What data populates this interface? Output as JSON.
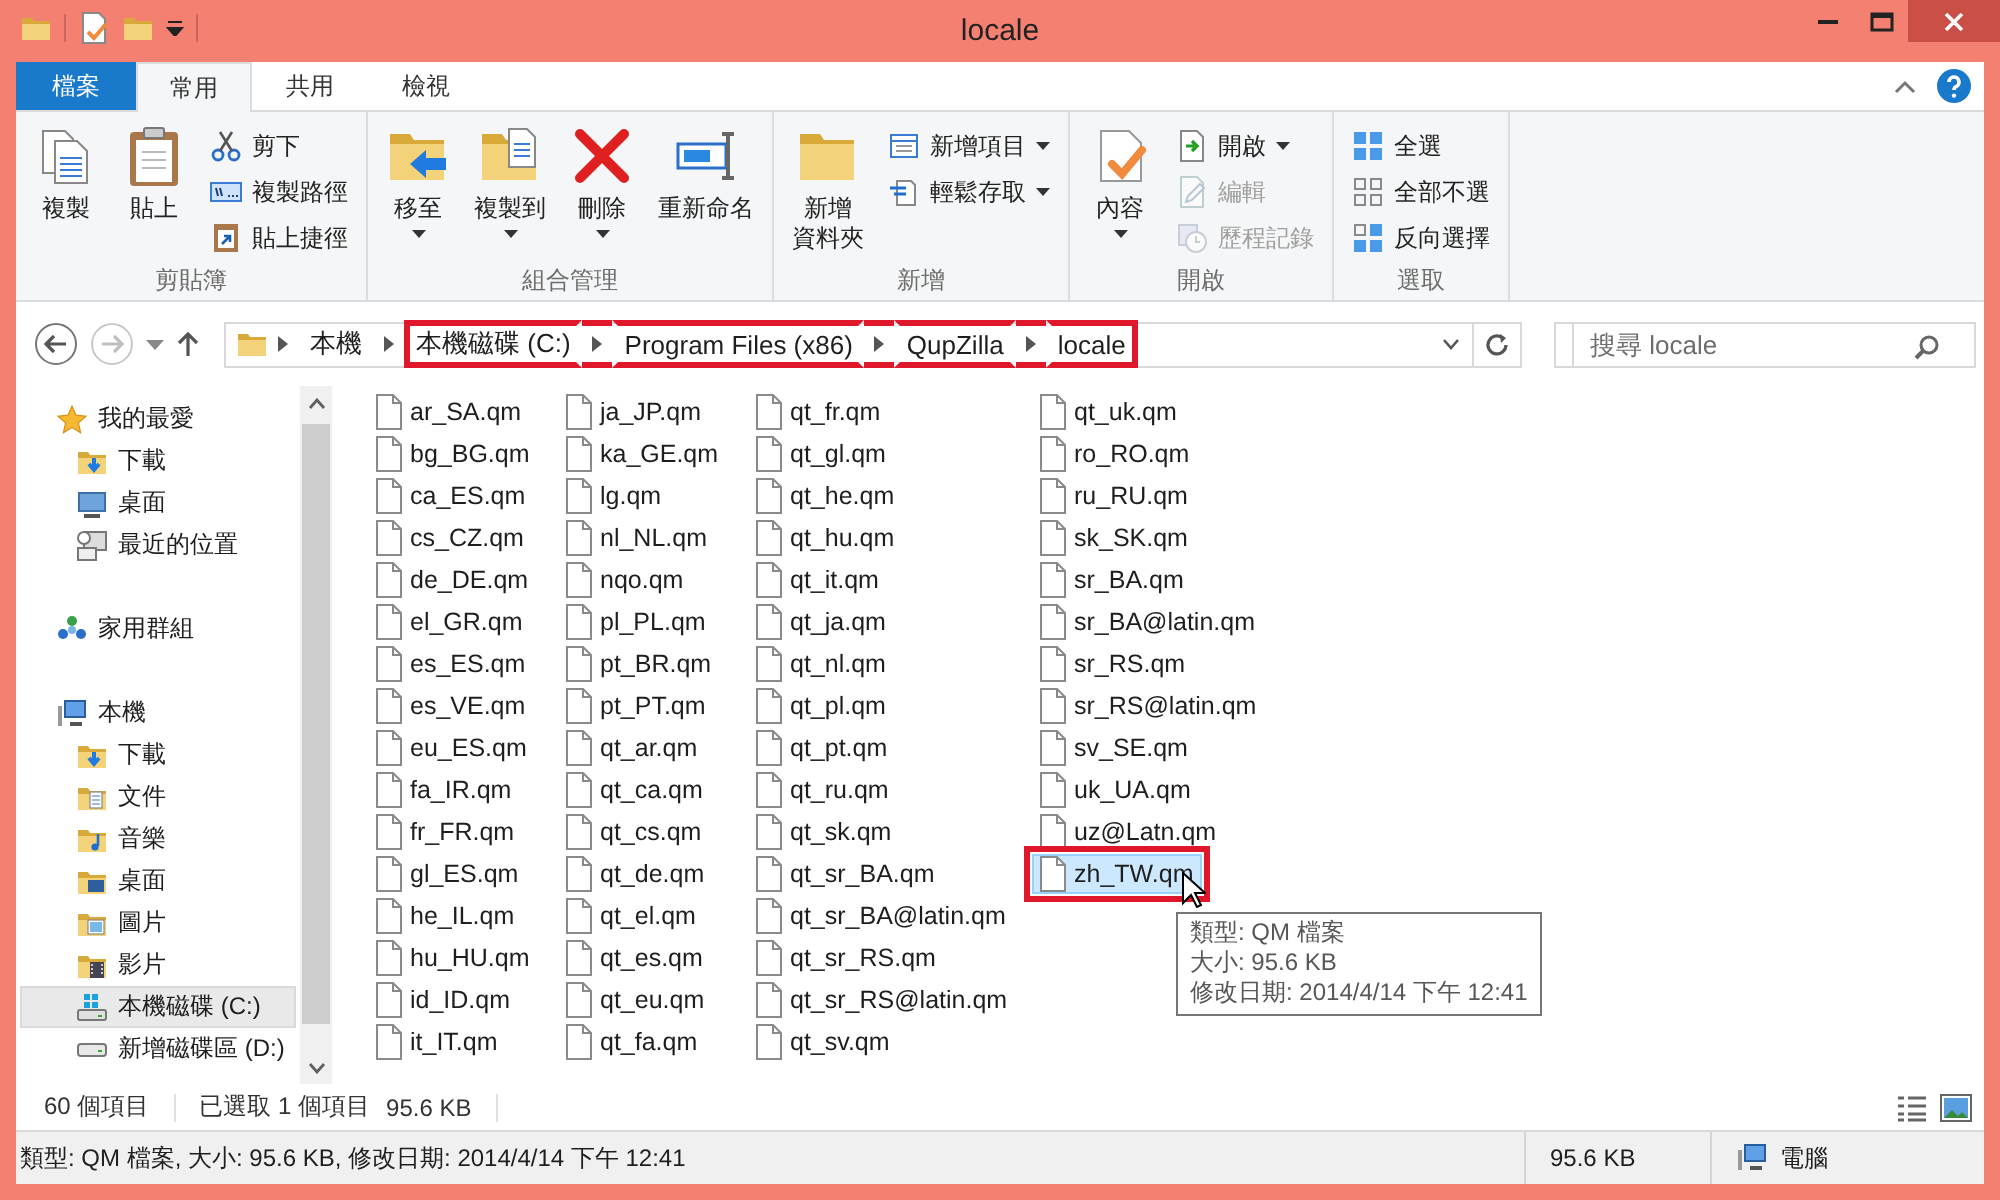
{
  "window": {
    "title": "locale"
  },
  "ribbon": {
    "file_tab": "檔案",
    "tabs": [
      {
        "label": "常用",
        "selected": true
      },
      {
        "label": "共用",
        "selected": false
      },
      {
        "label": "檢視",
        "selected": false
      }
    ],
    "groups": [
      {
        "label": "剪貼簿",
        "commands": [
          {
            "label": "複製",
            "kind": "large",
            "dropdown": false,
            "disabled": false
          },
          {
            "label": "貼上",
            "kind": "large",
            "dropdown": false,
            "disabled": false
          },
          {
            "label": "剪下",
            "kind": "small",
            "dropdown": false,
            "disabled": false
          },
          {
            "label": "複製路徑",
            "kind": "small",
            "dropdown": false,
            "disabled": false
          },
          {
            "label": "貼上捷徑",
            "kind": "small",
            "dropdown": false,
            "disabled": false
          }
        ]
      },
      {
        "label": "組合管理",
        "commands": [
          {
            "label": "移至",
            "kind": "large",
            "dropdown": true,
            "disabled": false
          },
          {
            "label": "複製到",
            "kind": "large",
            "dropdown": true,
            "disabled": false
          },
          {
            "label": "刪除",
            "kind": "large",
            "dropdown": true,
            "disabled": false
          },
          {
            "label": "重新命名",
            "kind": "large",
            "dropdown": false,
            "disabled": false
          }
        ]
      },
      {
        "label": "新增",
        "commands": [
          {
            "label_lines": [
              "新增",
              "資料夾"
            ],
            "kind": "large",
            "dropdown": false,
            "disabled": false
          },
          {
            "label": "新增項目",
            "kind": "small",
            "dropdown": true,
            "disabled": false
          },
          {
            "label": "輕鬆存取",
            "kind": "small",
            "dropdown": true,
            "disabled": false
          }
        ]
      },
      {
        "label": "開啟",
        "commands": [
          {
            "label": "內容",
            "kind": "large",
            "dropdown": true,
            "disabled": false
          },
          {
            "label": "開啟",
            "kind": "small",
            "dropdown": true,
            "disabled": false
          },
          {
            "label": "編輯",
            "kind": "small",
            "dropdown": false,
            "disabled": true
          },
          {
            "label": "歷程記錄",
            "kind": "small",
            "dropdown": false,
            "disabled": true
          }
        ]
      },
      {
        "label": "選取",
        "commands": [
          {
            "label": "全選",
            "kind": "small",
            "dropdown": false,
            "disabled": false
          },
          {
            "label": "全部不選",
            "kind": "small",
            "dropdown": false,
            "disabled": false
          },
          {
            "label": "反向選擇",
            "kind": "small",
            "dropdown": false,
            "disabled": false
          }
        ]
      }
    ]
  },
  "address": {
    "segments": [
      {
        "label": "本機",
        "annotated": false
      },
      {
        "label": "本機磁碟 (C:)",
        "annotated": true
      },
      {
        "label": "Program Files (x86)",
        "annotated": true
      },
      {
        "label": "QupZilla",
        "annotated": true
      },
      {
        "label": "locale",
        "annotated": true
      }
    ],
    "search": {
      "placeholder": "搜尋 locale"
    }
  },
  "navigation": {
    "items": [
      {
        "label": "我的最愛",
        "selected": false,
        "children": [
          {
            "label": "下載",
            "selected": false
          },
          {
            "label": "桌面",
            "selected": false
          },
          {
            "label": "最近的位置",
            "selected": false
          }
        ]
      },
      {
        "label": "家用群組",
        "selected": false
      },
      {
        "label": "本機",
        "selected": false,
        "children": [
          {
            "label": "下載",
            "selected": false
          },
          {
            "label": "文件",
            "selected": false
          },
          {
            "label": "音樂",
            "selected": false
          },
          {
            "label": "桌面",
            "selected": false
          },
          {
            "label": "圖片",
            "selected": false
          },
          {
            "label": "影片",
            "selected": false
          },
          {
            "label": "本機磁碟 (C:)",
            "selected": true
          },
          {
            "label": "新增磁碟區 (D:)",
            "selected": false
          }
        ]
      }
    ]
  },
  "files": [
    {
      "name": "ar_SA.qm",
      "selected": false,
      "annotated": false
    },
    {
      "name": "bg_BG.qm",
      "selected": false,
      "annotated": false
    },
    {
      "name": "ca_ES.qm",
      "selected": false,
      "annotated": false
    },
    {
      "name": "cs_CZ.qm",
      "selected": false,
      "annotated": false
    },
    {
      "name": "de_DE.qm",
      "selected": false,
      "annotated": false
    },
    {
      "name": "el_GR.qm",
      "selected": false,
      "annotated": false
    },
    {
      "name": "es_ES.qm",
      "selected": false,
      "annotated": false
    },
    {
      "name": "es_VE.qm",
      "selected": false,
      "annotated": false
    },
    {
      "name": "eu_ES.qm",
      "selected": false,
      "annotated": false
    },
    {
      "name": "fa_IR.qm",
      "selected": false,
      "annotated": false
    },
    {
      "name": "fr_FR.qm",
      "selected": false,
      "annotated": false
    },
    {
      "name": "gl_ES.qm",
      "selected": false,
      "annotated": false
    },
    {
      "name": "he_IL.qm",
      "selected": false,
      "annotated": false
    },
    {
      "name": "hu_HU.qm",
      "selected": false,
      "annotated": false
    },
    {
      "name": "id_ID.qm",
      "selected": false,
      "annotated": false
    },
    {
      "name": "it_IT.qm",
      "selected": false,
      "annotated": false
    },
    {
      "name": "ja_JP.qm",
      "selected": false,
      "annotated": false
    },
    {
      "name": "ka_GE.qm",
      "selected": false,
      "annotated": false
    },
    {
      "name": "lg.qm",
      "selected": false,
      "annotated": false
    },
    {
      "name": "nl_NL.qm",
      "selected": false,
      "annotated": false
    },
    {
      "name": "nqo.qm",
      "selected": false,
      "annotated": false
    },
    {
      "name": "pl_PL.qm",
      "selected": false,
      "annotated": false
    },
    {
      "name": "pt_BR.qm",
      "selected": false,
      "annotated": false
    },
    {
      "name": "pt_PT.qm",
      "selected": false,
      "annotated": false
    },
    {
      "name": "qt_ar.qm",
      "selected": false,
      "annotated": false
    },
    {
      "name": "qt_ca.qm",
      "selected": false,
      "annotated": false
    },
    {
      "name": "qt_cs.qm",
      "selected": false,
      "annotated": false
    },
    {
      "name": "qt_de.qm",
      "selected": false,
      "annotated": false
    },
    {
      "name": "qt_el.qm",
      "selected": false,
      "annotated": false
    },
    {
      "name": "qt_es.qm",
      "selected": false,
      "annotated": false
    },
    {
      "name": "qt_eu.qm",
      "selected": false,
      "annotated": false
    },
    {
      "name": "qt_fa.qm",
      "selected": false,
      "annotated": false
    },
    {
      "name": "qt_fr.qm",
      "selected": false,
      "annotated": false
    },
    {
      "name": "qt_gl.qm",
      "selected": false,
      "annotated": false
    },
    {
      "name": "qt_he.qm",
      "selected": false,
      "annotated": false
    },
    {
      "name": "qt_hu.qm",
      "selected": false,
      "annotated": false
    },
    {
      "name": "qt_it.qm",
      "selected": false,
      "annotated": false
    },
    {
      "name": "qt_ja.qm",
      "selected": false,
      "annotated": false
    },
    {
      "name": "qt_nl.qm",
      "selected": false,
      "annotated": false
    },
    {
      "name": "qt_pl.qm",
      "selected": false,
      "annotated": false
    },
    {
      "name": "qt_pt.qm",
      "selected": false,
      "annotated": false
    },
    {
      "name": "qt_ru.qm",
      "selected": false,
      "annotated": false
    },
    {
      "name": "qt_sk.qm",
      "selected": false,
      "annotated": false
    },
    {
      "name": "qt_sr_BA.qm",
      "selected": false,
      "annotated": false
    },
    {
      "name": "qt_sr_BA@latin.qm",
      "selected": false,
      "annotated": false
    },
    {
      "name": "qt_sr_RS.qm",
      "selected": false,
      "annotated": false
    },
    {
      "name": "qt_sr_RS@latin.qm",
      "selected": false,
      "annotated": false
    },
    {
      "name": "qt_sv.qm",
      "selected": false,
      "annotated": false
    },
    {
      "name": "qt_uk.qm",
      "selected": false,
      "annotated": false
    },
    {
      "name": "ro_RO.qm",
      "selected": false,
      "annotated": false
    },
    {
      "name": "ru_RU.qm",
      "selected": false,
      "annotated": false
    },
    {
      "name": "sk_SK.qm",
      "selected": false,
      "annotated": false
    },
    {
      "name": "sr_BA.qm",
      "selected": false,
      "annotated": false
    },
    {
      "name": "sr_BA@latin.qm",
      "selected": false,
      "annotated": false
    },
    {
      "name": "sr_RS.qm",
      "selected": false,
      "annotated": false
    },
    {
      "name": "sr_RS@latin.qm",
      "selected": false,
      "annotated": false
    },
    {
      "name": "sv_SE.qm",
      "selected": false,
      "annotated": false
    },
    {
      "name": "uk_UA.qm",
      "selected": false,
      "annotated": false
    },
    {
      "name": "uz@Latn.qm",
      "selected": false,
      "annotated": false
    },
    {
      "name": "zh_TW.qm",
      "selected": true,
      "annotated": true
    }
  ],
  "tooltip": {
    "lines": [
      "類型: QM 檔案",
      "大小: 95.6 KB",
      "修改日期: 2014/4/14 下午 12:41"
    ]
  },
  "status_bar": {
    "item_count": "60 個項目",
    "selection": "已選取 1 個項目",
    "selection_size": "95.6 KB"
  },
  "details_bar": {
    "summary": "類型: QM 檔案, 大小: 95.6 KB, 修改日期: 2014/4/14 下午 12:41",
    "size": "95.6 KB",
    "location": "電腦"
  }
}
